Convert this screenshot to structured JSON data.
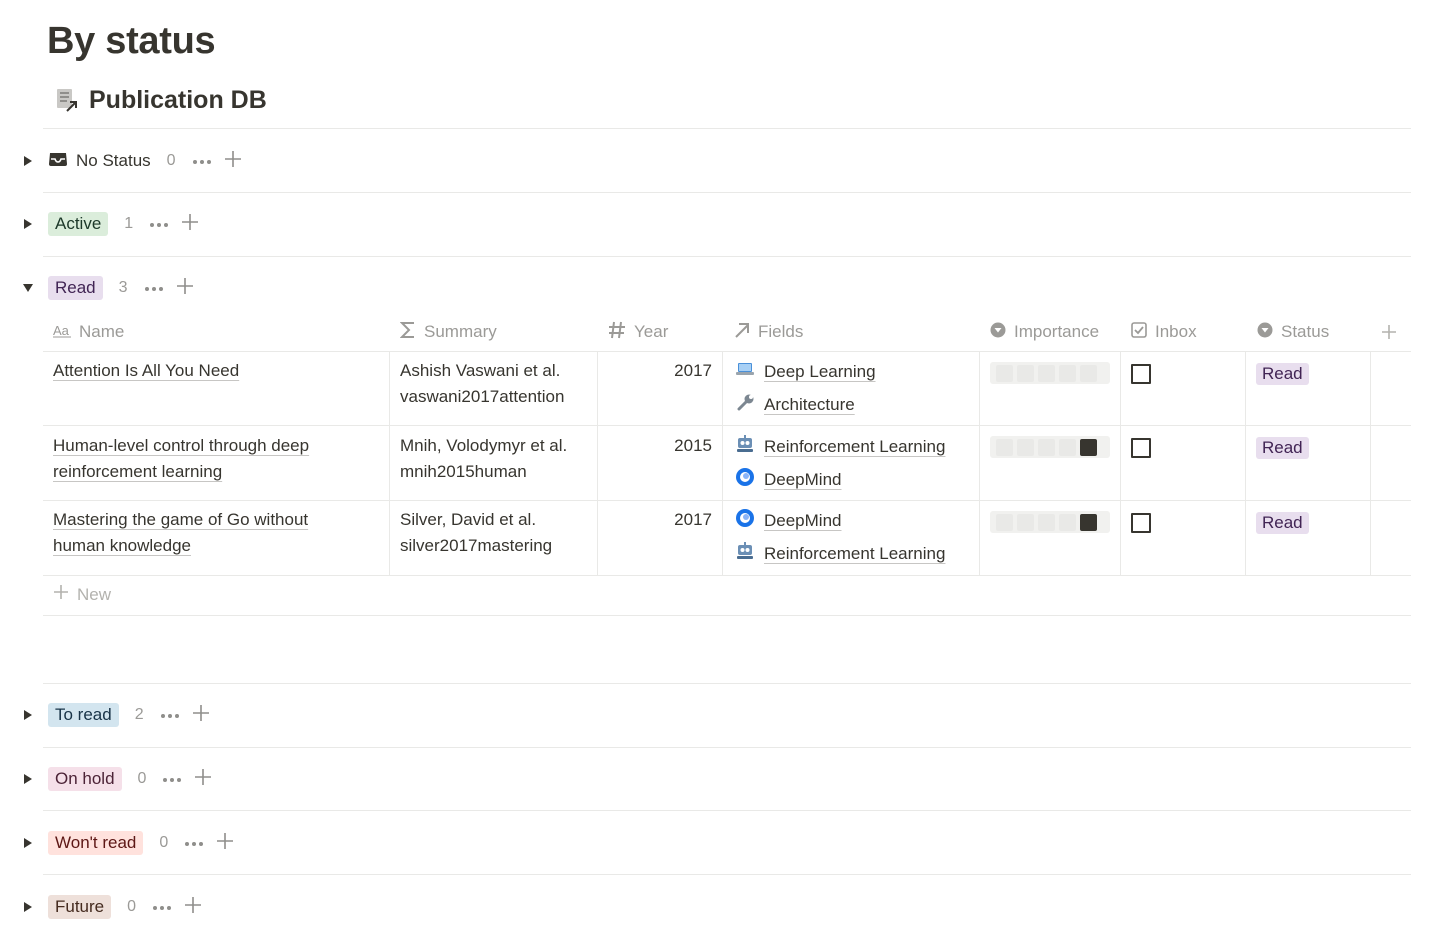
{
  "page": {
    "title": "By status"
  },
  "database": {
    "title": "Publication DB",
    "icon": "linked-database-icon"
  },
  "groups": {
    "no_status": {
      "label": "No Status",
      "count": "0"
    },
    "active": {
      "label": "Active",
      "count": "1",
      "color": "#dbeddb",
      "text_color": "#1c3829"
    },
    "read": {
      "label": "Read",
      "count": "3",
      "color": "#e8deee",
      "text_color": "#412454"
    },
    "to_read": {
      "label": "To read",
      "count": "2",
      "color": "#d3e5ef",
      "text_color": "#183347"
    },
    "on_hold": {
      "label": "On hold",
      "count": "0",
      "color": "#f5e0e9",
      "text_color": "#4c2337"
    },
    "wont_read": {
      "label": "Won't read",
      "count": "0",
      "color": "#ffe2dd",
      "text_color": "#5d1715"
    },
    "future": {
      "label": "Future",
      "count": "0",
      "color": "#eee0da",
      "text_color": "#442a1e"
    }
  },
  "table": {
    "columns": {
      "name": "Name",
      "summary": "Summary",
      "year": "Year",
      "fields": "Fields",
      "importance": "Importance",
      "inbox": "Inbox",
      "status": "Status"
    },
    "rows": [
      {
        "name": "Attention Is All You Need",
        "summary_line1": "Ashish Vaswani et al.",
        "summary_line2": "vaswani2017attention",
        "year": "2017",
        "fields": [
          {
            "label": "Deep Learning",
            "icon": "laptop-icon"
          },
          {
            "label": "Architecture",
            "icon": "wrench-icon"
          }
        ],
        "importance": 0,
        "inbox": false,
        "status": "Read"
      },
      {
        "name_line1": "Human-level control through deep",
        "name_line2": "reinforcement learning",
        "summary_line1": "Mnih, Volodymyr et al.",
        "summary_line2": "mnih2015human",
        "year": "2015",
        "fields": [
          {
            "label": "Reinforcement Learning",
            "icon": "robot-icon"
          },
          {
            "label": "DeepMind",
            "icon": "deepmind-icon"
          }
        ],
        "importance": 1,
        "inbox": false,
        "status": "Read"
      },
      {
        "name_line1": "Mastering the game of Go without",
        "name_line2": "human knowledge",
        "summary_line1": "Silver, David et al.",
        "summary_line2": "silver2017mastering",
        "year": "2017",
        "fields": [
          {
            "label": "DeepMind",
            "icon": "deepmind-icon"
          },
          {
            "label": "Reinforcement Learning",
            "icon": "robot-icon"
          }
        ],
        "importance": 1,
        "inbox": false,
        "status": "Read"
      }
    ],
    "new_label": "New"
  }
}
